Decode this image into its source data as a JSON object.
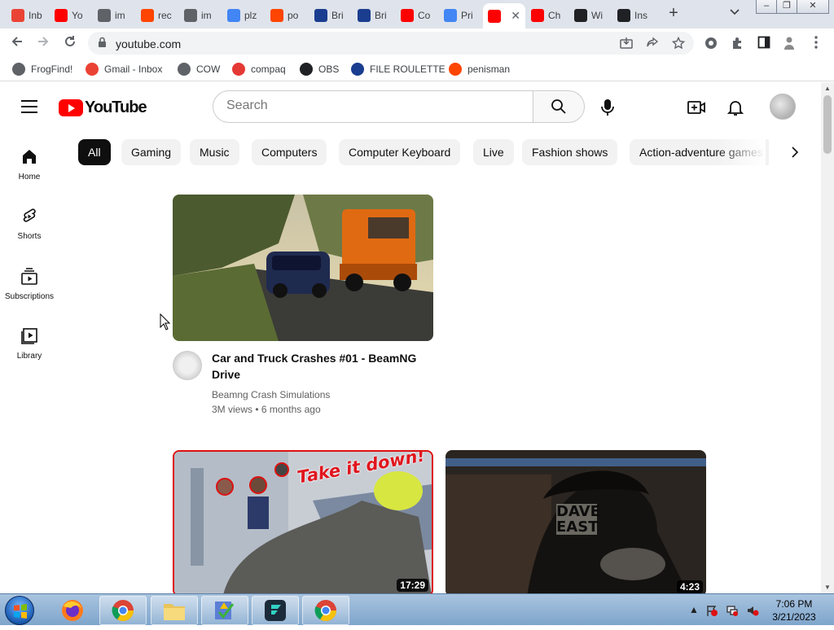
{
  "browser": {
    "tabs": [
      {
        "label": "Inb",
        "icon": "gmail-icon",
        "color": "#ea4335"
      },
      {
        "label": "Yo",
        "icon": "youtube-icon",
        "color": "#ff0000"
      },
      {
        "label": "im",
        "icon": "globe-icon",
        "color": "#5f6368"
      },
      {
        "label": "rec",
        "icon": "reddit-icon",
        "color": "#ff4500"
      },
      {
        "label": "im",
        "icon": "globe-icon",
        "color": "#5f6368"
      },
      {
        "label": "plz",
        "icon": "google-icon",
        "color": "#4285f4"
      },
      {
        "label": "po",
        "icon": "reddit-icon",
        "color": "#ff4500"
      },
      {
        "label": "Bri",
        "icon": "bri-icon",
        "color": "#1a3d8f"
      },
      {
        "label": "Bri",
        "icon": "bri-icon",
        "color": "#1a3d8f"
      },
      {
        "label": "Co",
        "icon": "youtube-icon",
        "color": "#ff0000"
      },
      {
        "label": "Pri",
        "icon": "google-icon",
        "color": "#4285f4"
      },
      {
        "label": "",
        "icon": "youtube-icon",
        "color": "#ff0000",
        "active": true
      },
      {
        "label": "Ch",
        "icon": "youtube-icon",
        "color": "#ff0000"
      },
      {
        "label": "Wi",
        "icon": "wikipedia-icon",
        "color": "#202124"
      },
      {
        "label": "Ins",
        "icon": "github-icon",
        "color": "#202124"
      }
    ],
    "address": {
      "url": "youtube.com"
    }
  },
  "bookmarks": [
    {
      "label": "FrogFind!",
      "icon": "globe-icon",
      "color": "#5f6368"
    },
    {
      "label": "Gmail - Inbox",
      "icon": "gmail-icon",
      "color": "#ea4335"
    },
    {
      "label": "COW",
      "icon": "globe-icon",
      "color": "#5f6368"
    },
    {
      "label": "compaq",
      "icon": "compaq-icon",
      "color": "#e53935"
    },
    {
      "label": "OBS",
      "icon": "github-icon",
      "color": "#202124"
    },
    {
      "label": "FILE ROULETTE",
      "icon": "file-roulette-icon",
      "color": "#1a3d8f"
    },
    {
      "label": "penisman",
      "icon": "reddit-icon",
      "color": "#ff4500"
    }
  ],
  "youtube": {
    "logo_text": "YouTube",
    "search_placeholder": "Search",
    "chips": [
      "All",
      "Gaming",
      "Music",
      "Computers",
      "Computer Keyboard",
      "Live",
      "Fashion shows",
      "Action-adventure games"
    ],
    "guide": [
      {
        "label": "Home",
        "icon": "home-icon"
      },
      {
        "label": "Shorts",
        "icon": "shorts-icon"
      },
      {
        "label": "Subscriptions",
        "icon": "subscriptions-icon"
      },
      {
        "label": "Library",
        "icon": "library-icon"
      }
    ],
    "videos": [
      {
        "title": "Car and Truck Crashes #01 - BeamNG Drive",
        "channel": "Beamng Crash Simulations",
        "views": "3M views",
        "age": "6 months ago",
        "duration": ""
      },
      {
        "title": "",
        "overlay_text": "Take it down!",
        "duration": "17:29"
      },
      {
        "title": "",
        "overlay_text": "DAVE EAST",
        "duration": "4:23"
      }
    ]
  },
  "taskbar": {
    "time": "7:06 PM",
    "date": "3/21/2023"
  }
}
